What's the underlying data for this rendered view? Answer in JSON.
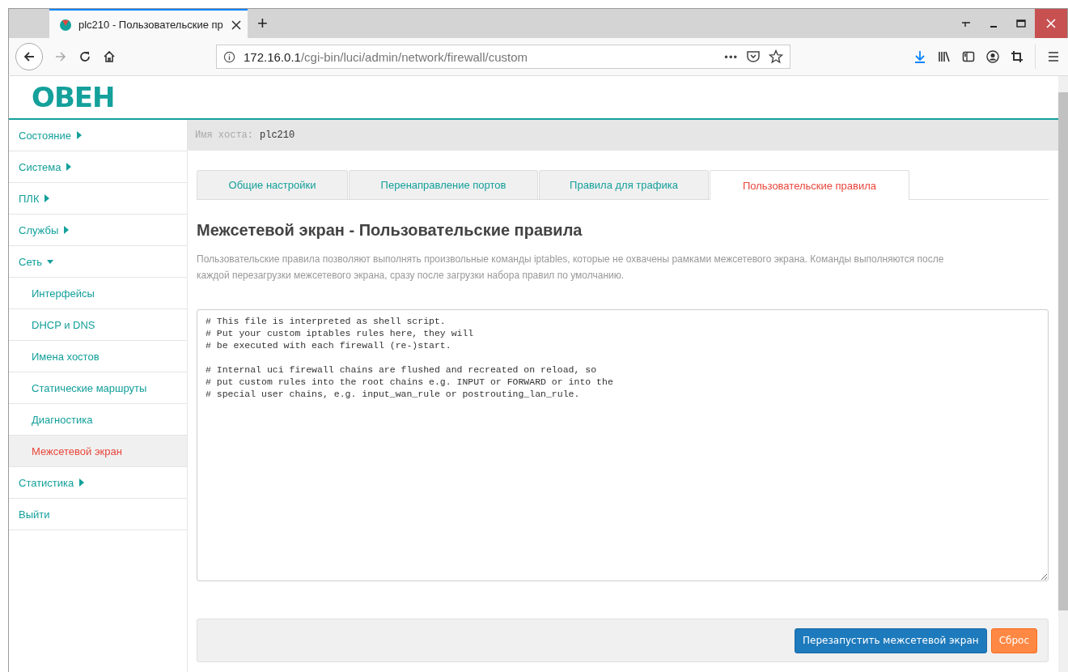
{
  "browser": {
    "tab_title": "plc210 - Пользовательские пр",
    "new_tab": "+",
    "url_host": "172.16.0.1",
    "url_path": "/cgi-bin/luci/admin/network/firewall/custom",
    "url_more": "•••"
  },
  "logo": "ОВЕН",
  "sidebar": {
    "items": [
      {
        "label": "Состояние",
        "expanded": false,
        "selected": false
      },
      {
        "label": "Система",
        "expanded": false,
        "selected": false
      },
      {
        "label": "ПЛК",
        "expanded": false,
        "selected": false
      },
      {
        "label": "Службы",
        "expanded": false,
        "selected": false
      },
      {
        "label": "Сеть",
        "expanded": true,
        "selected": false,
        "children": [
          {
            "label": "Интерфейсы",
            "selected": false
          },
          {
            "label": "DHCP и DNS",
            "selected": false
          },
          {
            "label": "Имена хостов",
            "selected": false
          },
          {
            "label": "Статические маршруты",
            "selected": false
          },
          {
            "label": "Диагностика",
            "selected": false
          },
          {
            "label": "Межсетевой экран",
            "selected": true
          }
        ]
      },
      {
        "label": "Статистика",
        "expanded": false,
        "selected": false
      },
      {
        "label": "Выйти",
        "selected": false
      }
    ]
  },
  "hostname": {
    "label": "Имя хоста:",
    "value": "plc210"
  },
  "tabs": [
    {
      "label": "Общие настройки",
      "selected": false
    },
    {
      "label": "Перенаправление портов",
      "selected": false
    },
    {
      "label": "Правила для трафика",
      "selected": false
    },
    {
      "label": "Пользовательские правила",
      "selected": true
    }
  ],
  "title": "Межсетевой экран - Пользовательские правила",
  "description": "Пользовательские правила позволяют выполнять произвольные команды iptables, которые не охвачены рамками межсетевого экрана. Команды выполняются после каждой перезагрузки межсетевого экрана, сразу после загрузки набора правил по умолчанию.",
  "editor": {
    "value": "# This file is interpreted as shell script.\n# Put your custom iptables rules here, they will\n# be executed with each firewall (re-)start.\n\n# Internal uci firewall chains are flushed and recreated on reload, so\n# put custom rules into the root chains e.g. INPUT or FORWARD or into the\n# special user chains, e.g. input_wan_rule or postrouting_lan_rule."
  },
  "buttons": [
    {
      "label": "Перезапустить межсетевой экран",
      "kind": "primary"
    },
    {
      "label": "Сброс",
      "kind": "reset"
    }
  ]
}
